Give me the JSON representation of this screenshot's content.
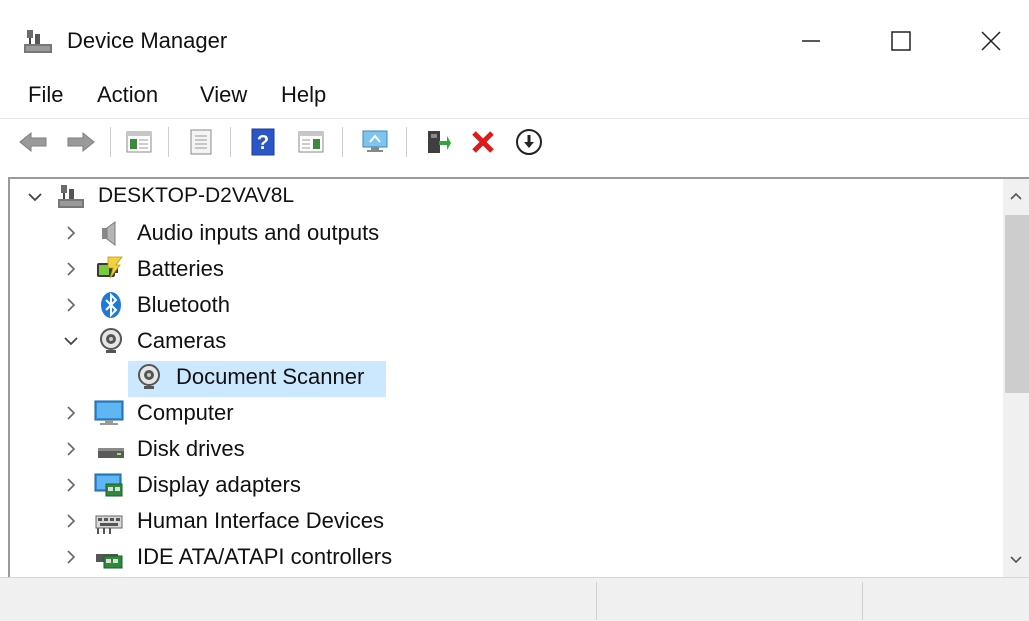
{
  "window": {
    "title": "Device Manager",
    "minimize": "—",
    "maximize": "☐",
    "close": "✕"
  },
  "menu": {
    "file": "File",
    "action": "Action",
    "view": "View",
    "help": "Help"
  },
  "tree": {
    "root": "DESKTOP-D2VAV8L",
    "items": [
      {
        "label": "Audio inputs and outputs",
        "expanded": false,
        "icon": "speaker-icon"
      },
      {
        "label": "Batteries",
        "expanded": false,
        "icon": "battery-icon"
      },
      {
        "label": "Bluetooth",
        "expanded": false,
        "icon": "bluetooth-icon"
      },
      {
        "label": "Cameras",
        "expanded": true,
        "icon": "camera-icon"
      },
      {
        "label": "Document Scanner",
        "child": true,
        "selected": true,
        "icon": "camera-icon"
      },
      {
        "label": "Computer",
        "expanded": false,
        "icon": "monitor-icon"
      },
      {
        "label": "Disk drives",
        "expanded": false,
        "icon": "disk-drive-icon"
      },
      {
        "label": "Display adapters",
        "expanded": false,
        "icon": "display-adapter-icon"
      },
      {
        "label": "Human Interface Devices",
        "expanded": false,
        "icon": "hid-icon"
      },
      {
        "label": "IDE ATA/ATAPI controllers",
        "expanded": false,
        "icon": "controller-card-icon"
      }
    ]
  },
  "colors": {
    "selection": "#cce8ff",
    "frame": "#9a9a9a",
    "remove_red": "#e01a1a",
    "help_blue": "#2a56c6"
  }
}
